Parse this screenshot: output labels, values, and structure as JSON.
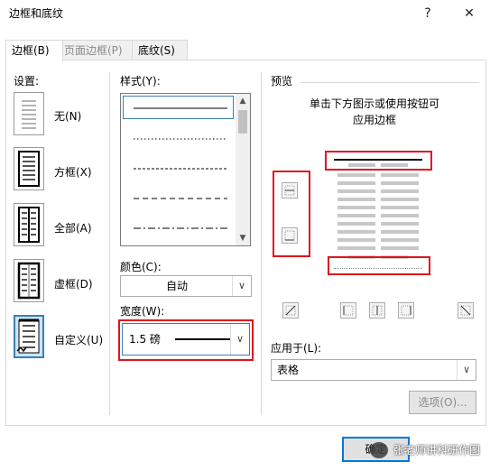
{
  "window": {
    "title": "边框和底纹",
    "help_label": "?",
    "close_label": "✕"
  },
  "tabs": [
    {
      "label": "边框(B)"
    },
    {
      "label": "页面边框(P)"
    },
    {
      "label": "底纹(S)"
    }
  ],
  "settings": {
    "label": "设置:",
    "items": [
      {
        "label": "无(N)"
      },
      {
        "label": "方框(X)"
      },
      {
        "label": "全部(A)"
      },
      {
        "label": "虚框(D)"
      },
      {
        "label": "自定义(U)"
      }
    ]
  },
  "style": {
    "label": "样式(Y):",
    "options": [
      "solid",
      "dotted",
      "dashed-small",
      "dashed",
      "dash-dot"
    ]
  },
  "color": {
    "label": "颜色(C):",
    "value": "自动"
  },
  "width": {
    "label": "宽度(W):",
    "value": "1.5 磅"
  },
  "preview": {
    "label": "预览",
    "hint_line1": "单击下方图示或使用按钮可",
    "hint_line2": "应用边框"
  },
  "apply_to": {
    "label": "应用于(L):",
    "value": "表格"
  },
  "options_button": {
    "label": "选项(O)..."
  },
  "ok_button": {
    "label": "确定"
  },
  "watermark": {
    "text": "张老师讲科研作图"
  },
  "accent_colors": {
    "highlight": "#e0141e",
    "selection": "#3c7fb1"
  }
}
